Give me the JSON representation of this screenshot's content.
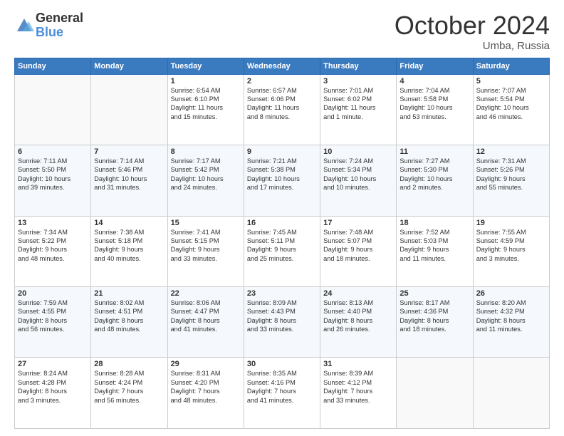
{
  "header": {
    "logo_line1": "General",
    "logo_line2": "Blue",
    "month": "October 2024",
    "location": "Umba, Russia"
  },
  "days_of_week": [
    "Sunday",
    "Monday",
    "Tuesday",
    "Wednesday",
    "Thursday",
    "Friday",
    "Saturday"
  ],
  "weeks": [
    [
      {
        "day": "",
        "info": ""
      },
      {
        "day": "",
        "info": ""
      },
      {
        "day": "1",
        "info": "Sunrise: 6:54 AM\nSunset: 6:10 PM\nDaylight: 11 hours\nand 15 minutes."
      },
      {
        "day": "2",
        "info": "Sunrise: 6:57 AM\nSunset: 6:06 PM\nDaylight: 11 hours\nand 8 minutes."
      },
      {
        "day": "3",
        "info": "Sunrise: 7:01 AM\nSunset: 6:02 PM\nDaylight: 11 hours\nand 1 minute."
      },
      {
        "day": "4",
        "info": "Sunrise: 7:04 AM\nSunset: 5:58 PM\nDaylight: 10 hours\nand 53 minutes."
      },
      {
        "day": "5",
        "info": "Sunrise: 7:07 AM\nSunset: 5:54 PM\nDaylight: 10 hours\nand 46 minutes."
      }
    ],
    [
      {
        "day": "6",
        "info": "Sunrise: 7:11 AM\nSunset: 5:50 PM\nDaylight: 10 hours\nand 39 minutes."
      },
      {
        "day": "7",
        "info": "Sunrise: 7:14 AM\nSunset: 5:46 PM\nDaylight: 10 hours\nand 31 minutes."
      },
      {
        "day": "8",
        "info": "Sunrise: 7:17 AM\nSunset: 5:42 PM\nDaylight: 10 hours\nand 24 minutes."
      },
      {
        "day": "9",
        "info": "Sunrise: 7:21 AM\nSunset: 5:38 PM\nDaylight: 10 hours\nand 17 minutes."
      },
      {
        "day": "10",
        "info": "Sunrise: 7:24 AM\nSunset: 5:34 PM\nDaylight: 10 hours\nand 10 minutes."
      },
      {
        "day": "11",
        "info": "Sunrise: 7:27 AM\nSunset: 5:30 PM\nDaylight: 10 hours\nand 2 minutes."
      },
      {
        "day": "12",
        "info": "Sunrise: 7:31 AM\nSunset: 5:26 PM\nDaylight: 9 hours\nand 55 minutes."
      }
    ],
    [
      {
        "day": "13",
        "info": "Sunrise: 7:34 AM\nSunset: 5:22 PM\nDaylight: 9 hours\nand 48 minutes."
      },
      {
        "day": "14",
        "info": "Sunrise: 7:38 AM\nSunset: 5:18 PM\nDaylight: 9 hours\nand 40 minutes."
      },
      {
        "day": "15",
        "info": "Sunrise: 7:41 AM\nSunset: 5:15 PM\nDaylight: 9 hours\nand 33 minutes."
      },
      {
        "day": "16",
        "info": "Sunrise: 7:45 AM\nSunset: 5:11 PM\nDaylight: 9 hours\nand 25 minutes."
      },
      {
        "day": "17",
        "info": "Sunrise: 7:48 AM\nSunset: 5:07 PM\nDaylight: 9 hours\nand 18 minutes."
      },
      {
        "day": "18",
        "info": "Sunrise: 7:52 AM\nSunset: 5:03 PM\nDaylight: 9 hours\nand 11 minutes."
      },
      {
        "day": "19",
        "info": "Sunrise: 7:55 AM\nSunset: 4:59 PM\nDaylight: 9 hours\nand 3 minutes."
      }
    ],
    [
      {
        "day": "20",
        "info": "Sunrise: 7:59 AM\nSunset: 4:55 PM\nDaylight: 8 hours\nand 56 minutes."
      },
      {
        "day": "21",
        "info": "Sunrise: 8:02 AM\nSunset: 4:51 PM\nDaylight: 8 hours\nand 48 minutes."
      },
      {
        "day": "22",
        "info": "Sunrise: 8:06 AM\nSunset: 4:47 PM\nDaylight: 8 hours\nand 41 minutes."
      },
      {
        "day": "23",
        "info": "Sunrise: 8:09 AM\nSunset: 4:43 PM\nDaylight: 8 hours\nand 33 minutes."
      },
      {
        "day": "24",
        "info": "Sunrise: 8:13 AM\nSunset: 4:40 PM\nDaylight: 8 hours\nand 26 minutes."
      },
      {
        "day": "25",
        "info": "Sunrise: 8:17 AM\nSunset: 4:36 PM\nDaylight: 8 hours\nand 18 minutes."
      },
      {
        "day": "26",
        "info": "Sunrise: 8:20 AM\nSunset: 4:32 PM\nDaylight: 8 hours\nand 11 minutes."
      }
    ],
    [
      {
        "day": "27",
        "info": "Sunrise: 8:24 AM\nSunset: 4:28 PM\nDaylight: 8 hours\nand 3 minutes."
      },
      {
        "day": "28",
        "info": "Sunrise: 8:28 AM\nSunset: 4:24 PM\nDaylight: 7 hours\nand 56 minutes."
      },
      {
        "day": "29",
        "info": "Sunrise: 8:31 AM\nSunset: 4:20 PM\nDaylight: 7 hours\nand 48 minutes."
      },
      {
        "day": "30",
        "info": "Sunrise: 8:35 AM\nSunset: 4:16 PM\nDaylight: 7 hours\nand 41 minutes."
      },
      {
        "day": "31",
        "info": "Sunrise: 8:39 AM\nSunset: 4:12 PM\nDaylight: 7 hours\nand 33 minutes."
      },
      {
        "day": "",
        "info": ""
      },
      {
        "day": "",
        "info": ""
      }
    ]
  ]
}
